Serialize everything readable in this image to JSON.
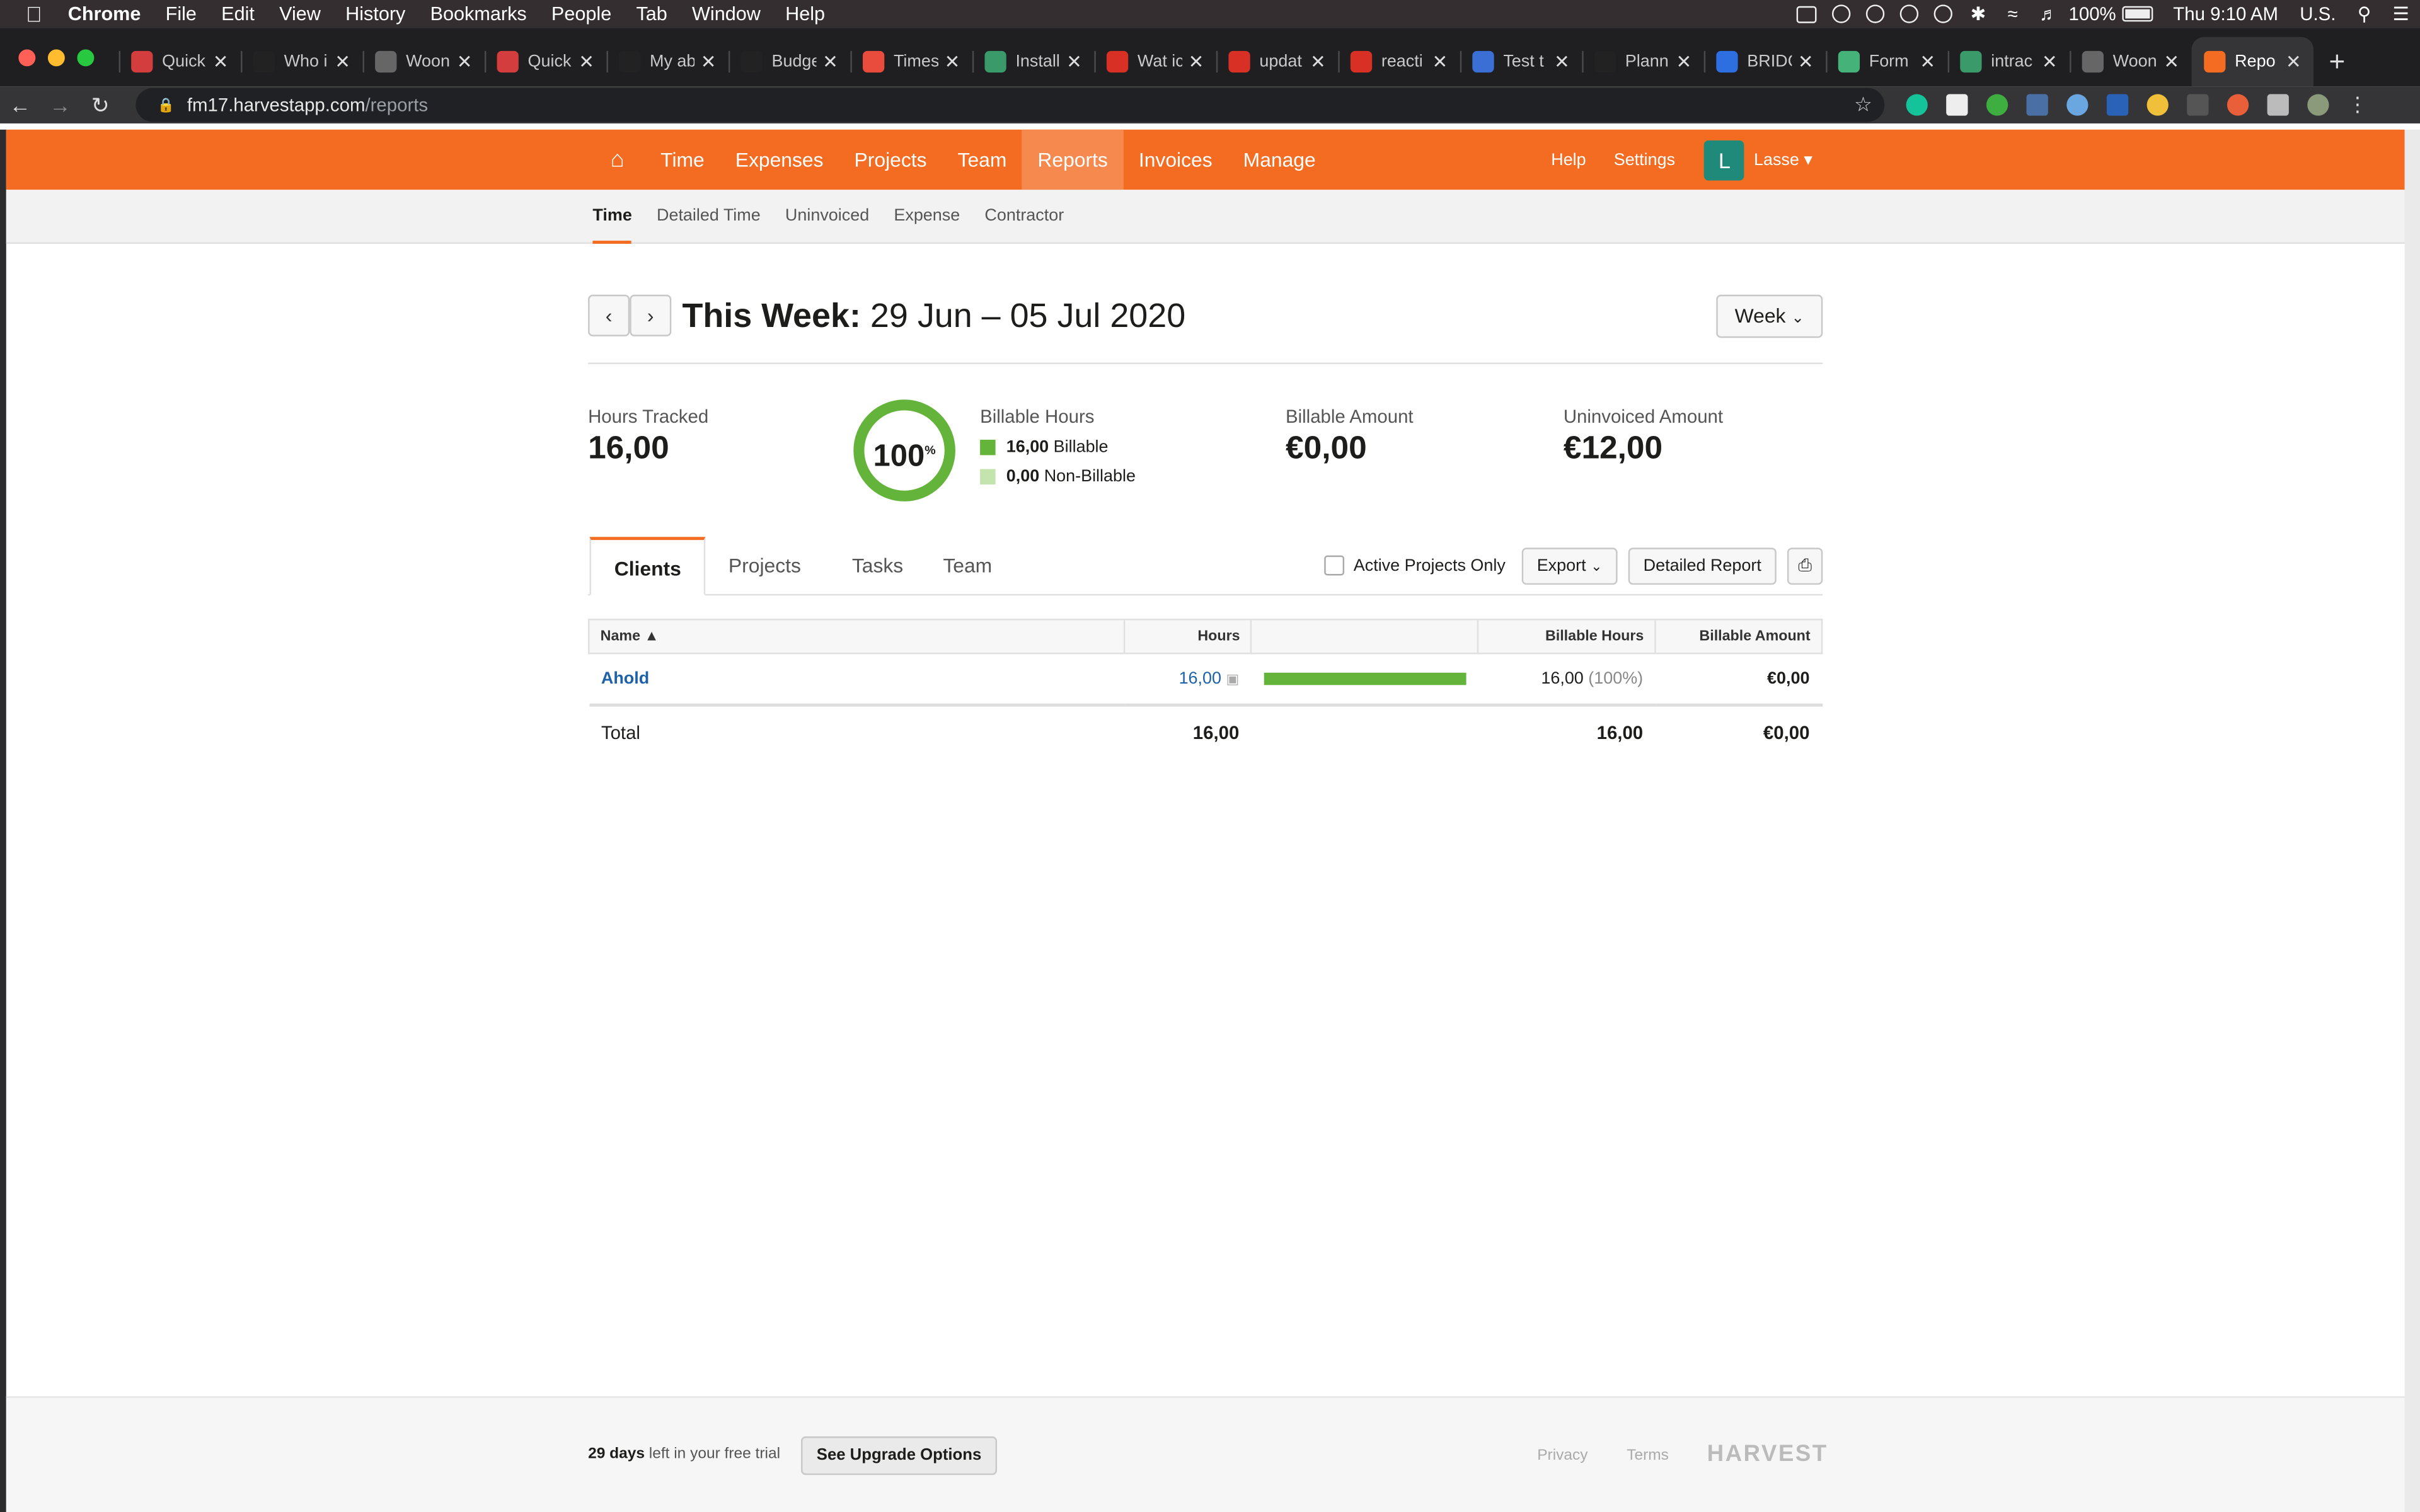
{
  "menubar": {
    "app": "Chrome",
    "items": [
      "File",
      "Edit",
      "View",
      "History",
      "Bookmarks",
      "People",
      "Tab",
      "Window",
      "Help"
    ],
    "battery": "100%",
    "clock": "Thu 9:10 AM",
    "input_source": "U.S."
  },
  "tabs": [
    {
      "title": "Quick",
      "color": "#d43d3d"
    },
    {
      "title": "Who i",
      "color": "#222222"
    },
    {
      "title": "Woon",
      "color": "#666666"
    },
    {
      "title": "Quick",
      "color": "#d43d3d"
    },
    {
      "title": "My ab",
      "color": "#222222"
    },
    {
      "title": "Budge",
      "color": "#222222"
    },
    {
      "title": "Times",
      "color": "#e94b3c"
    },
    {
      "title": "Install",
      "color": "#3a9a6a"
    },
    {
      "title": "Wat ic",
      "color": "#d93025"
    },
    {
      "title": "updat",
      "color": "#d93025"
    },
    {
      "title": "reacti",
      "color": "#d93025"
    },
    {
      "title": "Test t",
      "color": "#3b6fd6"
    },
    {
      "title": "Plann",
      "color": "#222222"
    },
    {
      "title": "BRIDC",
      "color": "#2d6ee0"
    },
    {
      "title": "Form",
      "color": "#45b27a"
    },
    {
      "title": "intrac",
      "color": "#3a9a6a"
    },
    {
      "title": "Woon",
      "color": "#666666"
    },
    {
      "title": "Repo",
      "color": "#f36c21",
      "active": true
    }
  ],
  "address": {
    "host": "fm17.harvestapp.com",
    "path": "/reports"
  },
  "nav": {
    "items": [
      "Time",
      "Expenses",
      "Projects",
      "Team",
      "Reports",
      "Invoices",
      "Manage"
    ],
    "active": "Reports",
    "help": "Help",
    "settings": "Settings",
    "avatar_letter": "L",
    "user": "Lasse"
  },
  "subnav": [
    "Time",
    "Detailed Time",
    "Uninvoiced",
    "Expense",
    "Contractor"
  ],
  "period": {
    "label": "This Week:",
    "range": "29 Jun – 05 Jul 2020",
    "selector": "Week"
  },
  "stats": {
    "hours_tracked_label": "Hours Tracked",
    "hours_tracked": "16,00",
    "billable_pct": "100",
    "billable_pct_sign": "%",
    "billable_hours_label": "Billable Hours",
    "billable_value": "16,00",
    "billable_text": "Billable",
    "nonbillable_value": "0,00",
    "nonbillable_text": "Non-Billable",
    "billable_amount_label": "Billable Amount",
    "billable_amount": "€0,00",
    "uninvoiced_label": "Uninvoiced Amount",
    "uninvoiced_amount": "€12,00"
  },
  "report_tabs": [
    "Clients",
    "Projects",
    "Tasks",
    "Team"
  ],
  "controls": {
    "active_projects": "Active Projects Only",
    "export": "Export",
    "detailed": "Detailed Report"
  },
  "table": {
    "headers": {
      "name": "Name",
      "hours": "Hours",
      "billable_hours": "Billable Hours",
      "billable_amount": "Billable Amount"
    },
    "rows": [
      {
        "name": "Ahold",
        "hours": "16,00",
        "billable_fraction": 1.0,
        "billable_hours": "16,00",
        "billable_pct": "(100%)",
        "amount": "€0,00"
      }
    ],
    "total": {
      "label": "Total",
      "hours": "16,00",
      "billable_hours": "16,00",
      "amount": "€0,00"
    }
  },
  "footer": {
    "days": "29 days",
    "trial_text": "left in your free trial",
    "upgrade": "See Upgrade Options",
    "privacy": "Privacy",
    "terms": "Terms",
    "brand": "HARVEST"
  },
  "colors": {
    "brand": "#f36c21",
    "billable": "#64b33a",
    "nonbillable": "#c3e4ad",
    "link": "#1d62a8"
  }
}
